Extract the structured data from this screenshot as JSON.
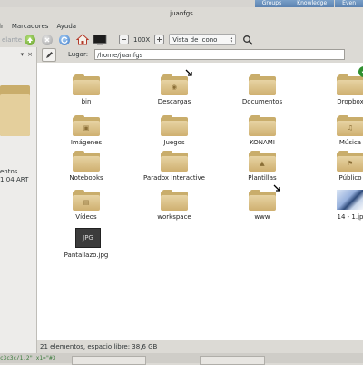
{
  "window": {
    "title": "juanfgs",
    "background_tabs": [
      "Groups",
      "Knowledge",
      "Even"
    ]
  },
  "menubar": {
    "items": [
      "lr",
      "Marcadores",
      "Ayuda"
    ]
  },
  "toolbar": {
    "back_label": "elante",
    "zoom_value": "100X",
    "view_mode": "Vista de icono"
  },
  "sidebar": {
    "controls": [
      "▾",
      "×"
    ],
    "info_line1": "entos",
    "info_line2": "1:04 ART"
  },
  "location": {
    "label": "Lugar:",
    "path": "/home/juanfgs"
  },
  "files": [
    {
      "name": "bin",
      "kind": "folder",
      "emblem": "",
      "badge": ""
    },
    {
      "name": "Descargas",
      "kind": "folder",
      "emblem": "download",
      "badge": "arrow"
    },
    {
      "name": "Documentos",
      "kind": "folder",
      "emblem": "",
      "badge": ""
    },
    {
      "name": "Dropbox",
      "kind": "folder",
      "emblem": "",
      "badge": "check"
    },
    {
      "name": "Imágenes",
      "kind": "folder",
      "emblem": "image",
      "badge": ""
    },
    {
      "name": "Juegos",
      "kind": "folder",
      "emblem": "",
      "badge": ""
    },
    {
      "name": "KONAMI",
      "kind": "folder",
      "emblem": "",
      "badge": ""
    },
    {
      "name": "Música",
      "kind": "folder",
      "emblem": "music",
      "badge": ""
    },
    {
      "name": "Notebooks",
      "kind": "folder",
      "emblem": "",
      "badge": ""
    },
    {
      "name": "Paradox Interactive",
      "kind": "folder",
      "emblem": "",
      "badge": ""
    },
    {
      "name": "Plantillas",
      "kind": "folder",
      "emblem": "template",
      "badge": ""
    },
    {
      "name": "Público",
      "kind": "folder",
      "emblem": "share",
      "badge": ""
    },
    {
      "name": "Vídeos",
      "kind": "folder",
      "emblem": "video",
      "badge": ""
    },
    {
      "name": "workspace",
      "kind": "folder",
      "emblem": "",
      "badge": ""
    },
    {
      "name": "www",
      "kind": "folder",
      "emblem": "",
      "badge": "arrow"
    },
    {
      "name": "14 - 1.jp",
      "kind": "photo",
      "emblem": "",
      "badge": ""
    },
    {
      "name": "Pantallazo.jpg",
      "kind": "jpg",
      "emblem": "",
      "badge": "",
      "thumb_text": "JPG"
    }
  ],
  "status": {
    "text": "21 elementos, espacio libre: 38,6 GB"
  },
  "bottom": {
    "code_snippet": "c3c3c/1.2\" x1=\"#3"
  },
  "colors": {
    "window_bg": "#dcdad5",
    "folder": "#c9ad6b",
    "accent_tab": "#5b82b0"
  }
}
